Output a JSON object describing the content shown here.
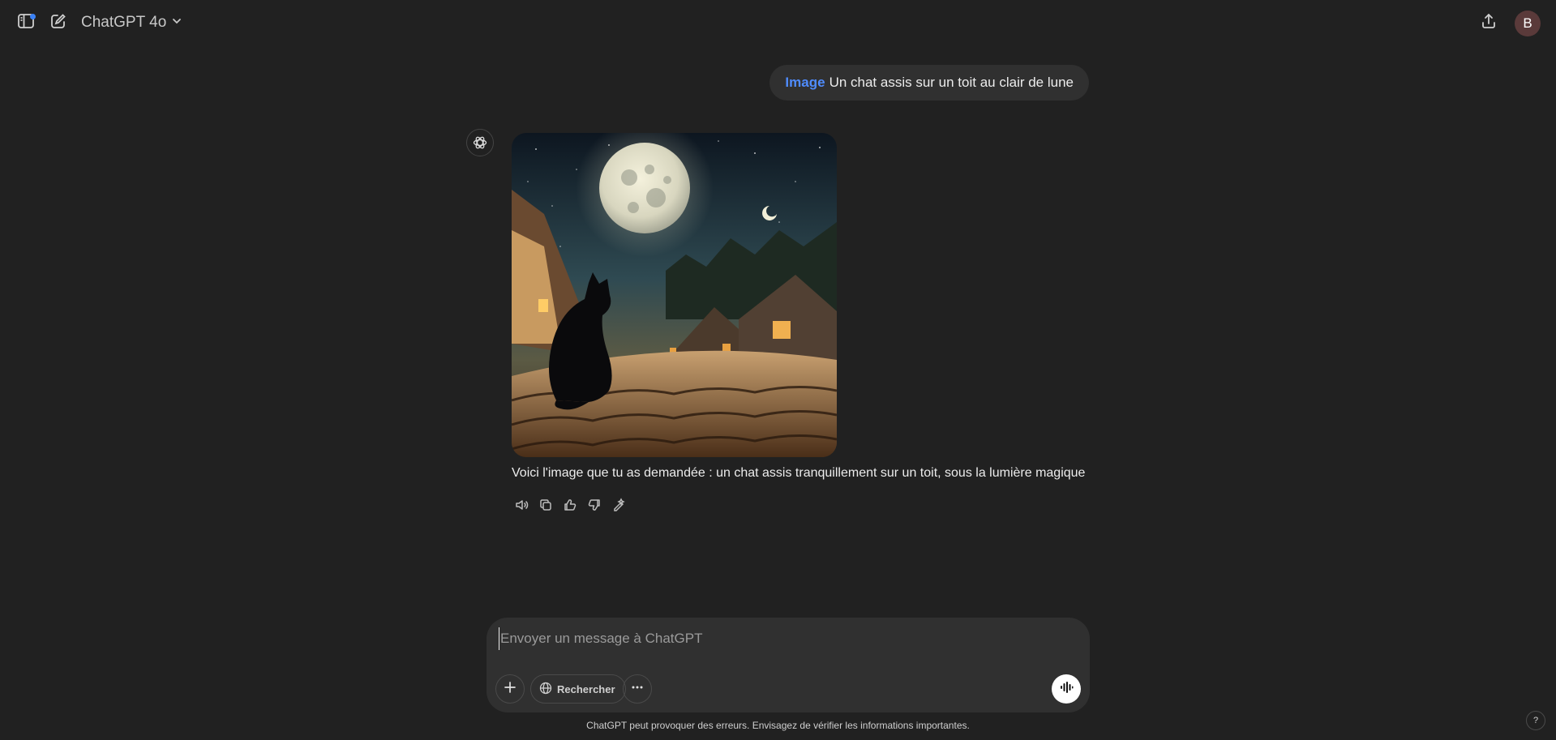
{
  "header": {
    "model_name": "ChatGPT 4o",
    "avatar_initial": "B",
    "icons": [
      "sidebar-toggle-icon",
      "new-chat-icon",
      "chevron-down-icon",
      "share-icon"
    ]
  },
  "conversation": {
    "user_message": {
      "tag": "Image",
      "text": "Un chat assis sur un toit au clair de lune"
    },
    "assistant_message": {
      "text": "Voici l'image que tu as demandée : un chat assis tranquillement sur un toit, sous la lumière magique",
      "action_icons": [
        "read-aloud-icon",
        "copy-icon",
        "thumbs-up-icon",
        "thumbs-down-icon",
        "edit-image-icon"
      ]
    }
  },
  "composer": {
    "placeholder": "Envoyer un message à ChatGPT",
    "search_label": "Rechercher",
    "icons": [
      "plus-icon",
      "globe-icon",
      "more-icon",
      "voice-mode-icon"
    ]
  },
  "footer": {
    "disclaimer": "ChatGPT peut provoquer des erreurs. Envisagez de vérifier les informations importantes.",
    "help_label": "?"
  },
  "colors": {
    "background": "#212121",
    "bubble": "#303030",
    "accent": "#4f8cff",
    "notification_dot": "#3b82f6"
  }
}
